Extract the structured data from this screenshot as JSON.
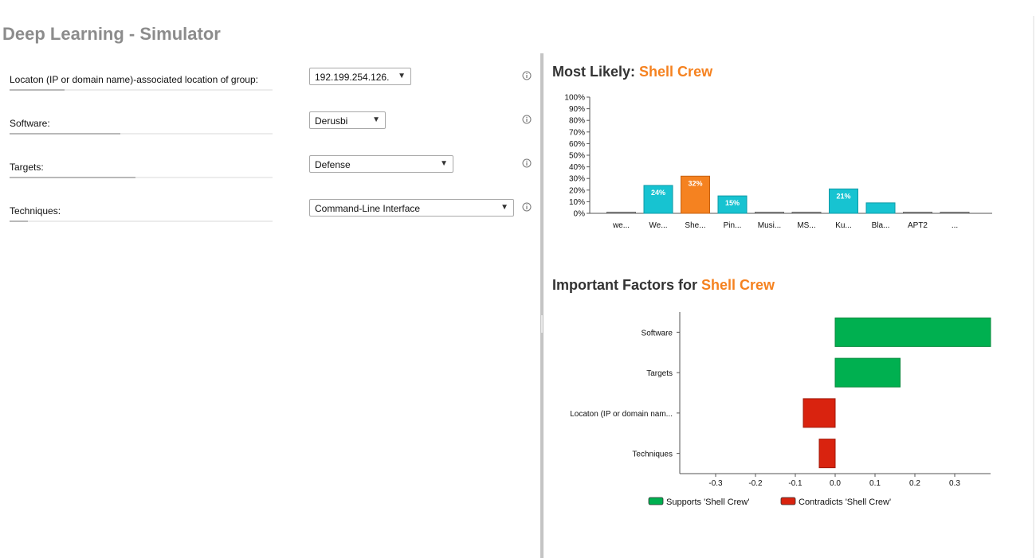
{
  "app": {
    "title": "Deep Learning - Simulator"
  },
  "colors": {
    "accent": "#f58220",
    "teal": "#17c3d1",
    "green": "#00b050",
    "red": "#d9230f",
    "gray_bar": "#a6a6a6"
  },
  "form": {
    "fields": [
      {
        "label": "Locaton (IP or domain name)-associated location of group:",
        "value": "192.199.254.126.",
        "weight": 0.21
      },
      {
        "label": "Software:",
        "value": "Derusbi",
        "weight": 0.42
      },
      {
        "label": "Targets:",
        "value": "Defense",
        "weight": 0.48
      },
      {
        "label": "Techniques:",
        "value": "Command-Line Interface",
        "weight": 0.07
      }
    ],
    "info_icon": "info-circle-icon",
    "dropdown_icon": "caret-down-icon",
    "caret": "▼"
  },
  "likely_panel": {
    "heading_prefix": "Most Likely:",
    "heading_name": "Shell Crew"
  },
  "factors_panel": {
    "heading_prefix": "Important Factors for",
    "heading_name": "Shell Crew"
  },
  "chart_data": [
    {
      "type": "bar",
      "categories": [
        "we...",
        "We...",
        "She...",
        "Pin...",
        "Musi...",
        "MS...",
        "Ku...",
        "Bla...",
        "APT2",
        "..."
      ],
      "values": [
        1,
        24,
        32,
        15,
        1,
        1,
        21,
        9,
        1,
        1
      ],
      "value_labels": [
        "",
        "24%",
        "32%",
        "15%",
        "",
        "",
        "21%",
        "",
        "",
        ""
      ],
      "highlight_index": 2,
      "ylim": [
        0,
        100
      ],
      "yticks": [
        "0%",
        "10%",
        "20%",
        "30%",
        "40%",
        "50%",
        "60%",
        "70%",
        "80%",
        "90%",
        "100%"
      ]
    },
    {
      "type": "bar",
      "orientation": "horizontal",
      "categories": [
        "Software",
        "Targets",
        "Locaton (IP or domain nam...",
        "Techniques"
      ],
      "values": [
        0.39,
        0.163,
        -0.08,
        -0.04
      ],
      "xlim": [
        -0.39,
        0.39
      ],
      "xticks": [
        -0.3,
        -0.2,
        -0.1,
        0.0,
        0.1,
        0.2,
        0.3
      ],
      "xtick_labels": [
        "-0.3",
        "-0.2",
        "-0.1",
        "0.0",
        "0.1",
        "0.2",
        "0.3"
      ],
      "legend": [
        {
          "label": "Supports 'Shell Crew'",
          "color": "#00b050"
        },
        {
          "label": "Contradicts 'Shell Crew'",
          "color": "#d9230f"
        }
      ]
    }
  ]
}
